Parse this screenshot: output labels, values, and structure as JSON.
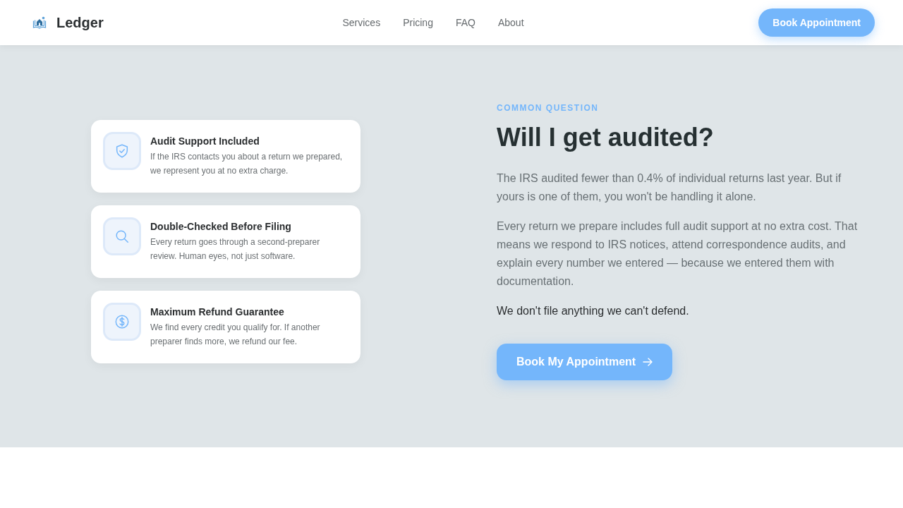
{
  "header": {
    "logo": "Ledger",
    "nav": [
      {
        "label": "Services"
      },
      {
        "label": "Pricing"
      },
      {
        "label": "FAQ"
      },
      {
        "label": "About"
      }
    ],
    "cta": "Book Appointment"
  },
  "features": [
    {
      "kind": "shield",
      "title": "Audit Support Included",
      "description": "If the IRS contacts you about a return we prepared, we represent you at no extra charge."
    },
    {
      "kind": "search",
      "title": "Double-Checked Before Filing",
      "description": "Every return goes through a second-preparer review. Human eyes, not just software."
    },
    {
      "kind": "dollar",
      "title": "Maximum Refund Guarantee",
      "description": "We find every credit you qualify for. If another preparer finds more, we refund our fee."
    }
  ],
  "faq": {
    "eyebrow": "COMMON QUESTION",
    "title": "Will I get audited?",
    "paragraphs": [
      "The IRS audited fewer than 0.4% of individual returns last year. But if yours is one of them, you won't be handling it alone.",
      "Every return we prepare includes full audit support at no extra cost. That means we respond to IRS notices, attend correspondence audits, and explain every number we entered — because we entered them with documentation."
    ],
    "emphasis": "We don't file anything we can't defend.",
    "button": "Book My Appointment"
  }
}
